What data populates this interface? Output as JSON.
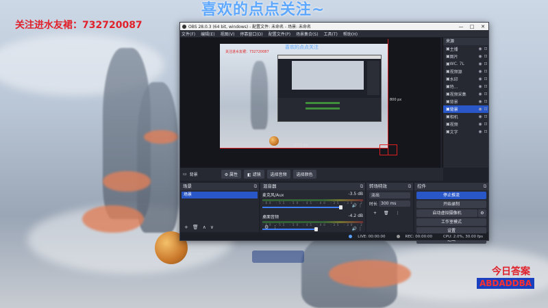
{
  "overlay": {
    "top_text": "喜欢的点点关注~",
    "left_text": "关注进水友裙：732720087",
    "answer_label": "今日答案",
    "answer_code": "ABDADDBA"
  },
  "window": {
    "title": "OBS 28.0.3 (64 bit, windows) - 配置文件: 未命名 - 场景: 未命名",
    "controls": [
      "—",
      "□",
      "✕"
    ]
  },
  "menu": [
    "文件(F)",
    "编辑(E)",
    "视图(V)",
    "停靠窗口(D)",
    "配置文件(P)",
    "场景集合(S)",
    "工具(T)",
    "帮助(H)"
  ],
  "preview": {
    "inner_overlay_top": "喜欢的点点关注",
    "inner_overlay_left": "关注进水友裙：732720087",
    "size_right": "800 px",
    "size_bottom": "1920 px"
  },
  "sources": {
    "header": "来源",
    "items": [
      {
        "name": "主播",
        "selected": false
      },
      {
        "name": "图片",
        "selected": false
      },
      {
        "name": "WC. 7L",
        "selected": false
      },
      {
        "name": "视频源",
        "selected": false
      },
      {
        "name": "水印",
        "selected": false
      },
      {
        "name": "特...",
        "selected": false
      },
      {
        "name": "视频采集",
        "selected": false
      },
      {
        "name": "背景",
        "selected": false
      },
      {
        "name": "背景",
        "selected": true
      },
      {
        "name": "相机",
        "selected": false
      },
      {
        "name": "视频",
        "selected": false
      },
      {
        "name": "文字",
        "selected": false
      }
    ]
  },
  "toolbar": {
    "scene_name": "背景",
    "buttons": [
      "属性",
      "滤镜",
      "选择音频",
      "选择颜色"
    ]
  },
  "scenes": {
    "header": "场景",
    "items": [
      "场景"
    ]
  },
  "mixer": {
    "header": "混音器",
    "channels": [
      {
        "name": "麦克风/Aux",
        "db": "-3.5 dB",
        "level": 0.95
      },
      {
        "name": "桌面音频",
        "db": "-4.2 dB",
        "level": 0.65
      }
    ],
    "ticks": "-60 -55 -50 -45 -40 -35 -30 -25 -20 -15 -10 -5 0"
  },
  "transitions": {
    "header": "转场特效",
    "type": "淡出",
    "duration_label": "时长",
    "duration_value": "300 ms"
  },
  "controls": {
    "header": "控件",
    "buttons": [
      {
        "label": "停止推流",
        "active": true
      },
      {
        "label": "开始录制",
        "active": false
      },
      {
        "label": "启动虚拟摄像机",
        "active": false
      },
      {
        "label": "工作室模式",
        "active": false
      },
      {
        "label": "设置",
        "active": false
      },
      {
        "label": "退出",
        "active": false
      }
    ]
  },
  "status": {
    "live": "LIVE: 00:00:00",
    "rec": "REC: 00:00:00",
    "cpu": "CPU: 2.0%, 30.00 fps"
  }
}
